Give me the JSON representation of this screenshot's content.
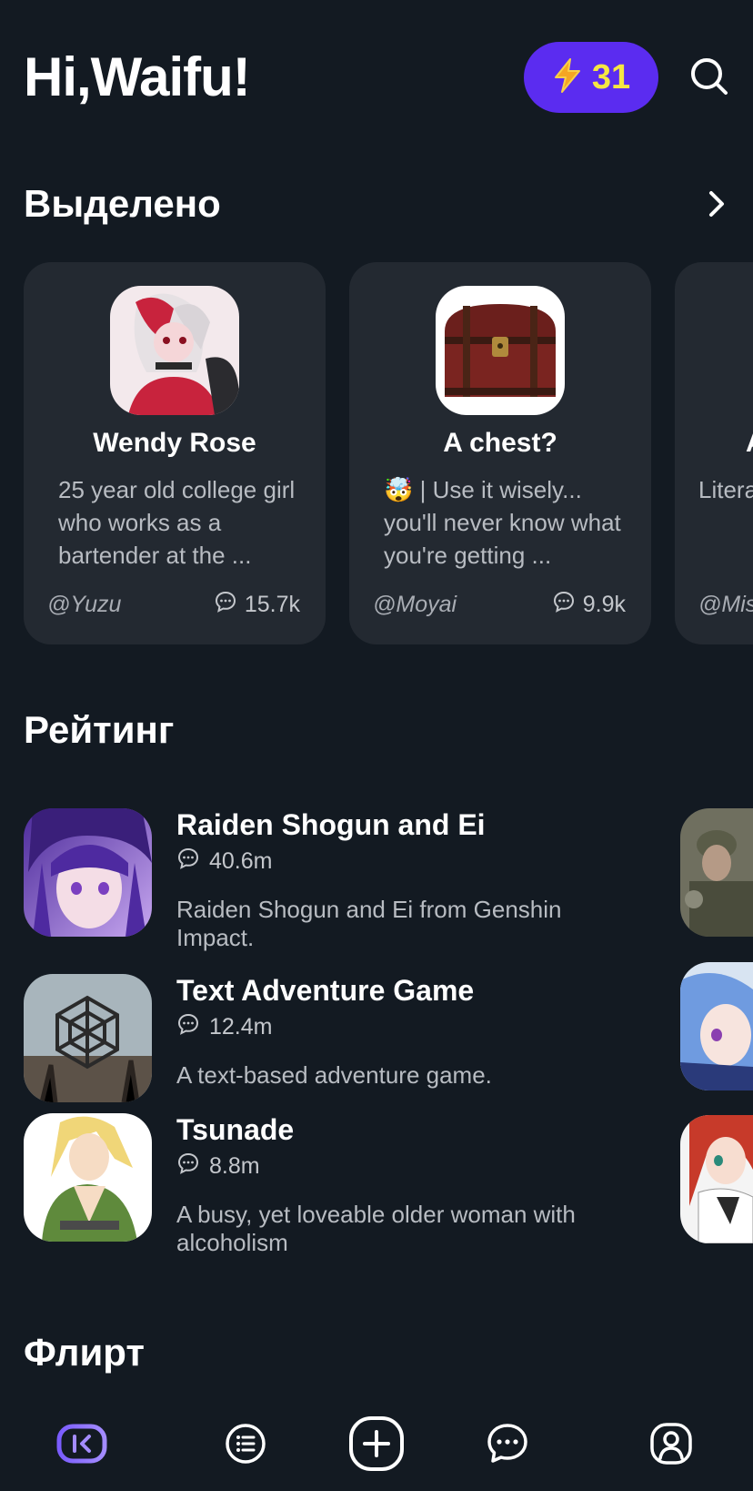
{
  "header": {
    "greeting": "Hi,Waifu!",
    "energy_count": "31",
    "energy_icon": "lightning-icon",
    "search_icon": "search-icon"
  },
  "featured": {
    "title": "Выделено",
    "cards": [
      {
        "name": "Wendy Rose",
        "description": "25 year old college girl who works as a bartender at the ...",
        "author": "@Yuzu",
        "chats": "15.7k"
      },
      {
        "name": "A chest?",
        "description": "🤯 | Use it wisely... you'll never know what you're getting ...",
        "author": "@Moyai",
        "chats": "9.9k"
      },
      {
        "name": "A",
        "description": "Litera you c doinc",
        "author": "@Mis",
        "chats": ""
      }
    ]
  },
  "rating": {
    "title": "Рейтинг",
    "items": [
      {
        "name": "Raiden Shogun and Ei",
        "chats": "40.6m",
        "description": "Raiden Shogun and Ei from Genshin Impact."
      },
      {
        "name": "Text Adventure Game",
        "chats": "12.4m",
        "description": "A text-based adventure game."
      },
      {
        "name": "Tsunade",
        "chats": "8.8m",
        "description": "A busy, yet loveable older woman with alcoholism"
      }
    ]
  },
  "flirt": {
    "title": "Флирт"
  },
  "nav": {
    "items": [
      "home-icon",
      "list-icon",
      "add-icon",
      "chat-icon",
      "profile-icon"
    ],
    "active": "home-icon"
  },
  "colors": {
    "background": "#131a22",
    "card": "#232931",
    "accent": "#5b2cf0",
    "energy_text": "#f5e642",
    "nav_active": "#8e7cff"
  }
}
